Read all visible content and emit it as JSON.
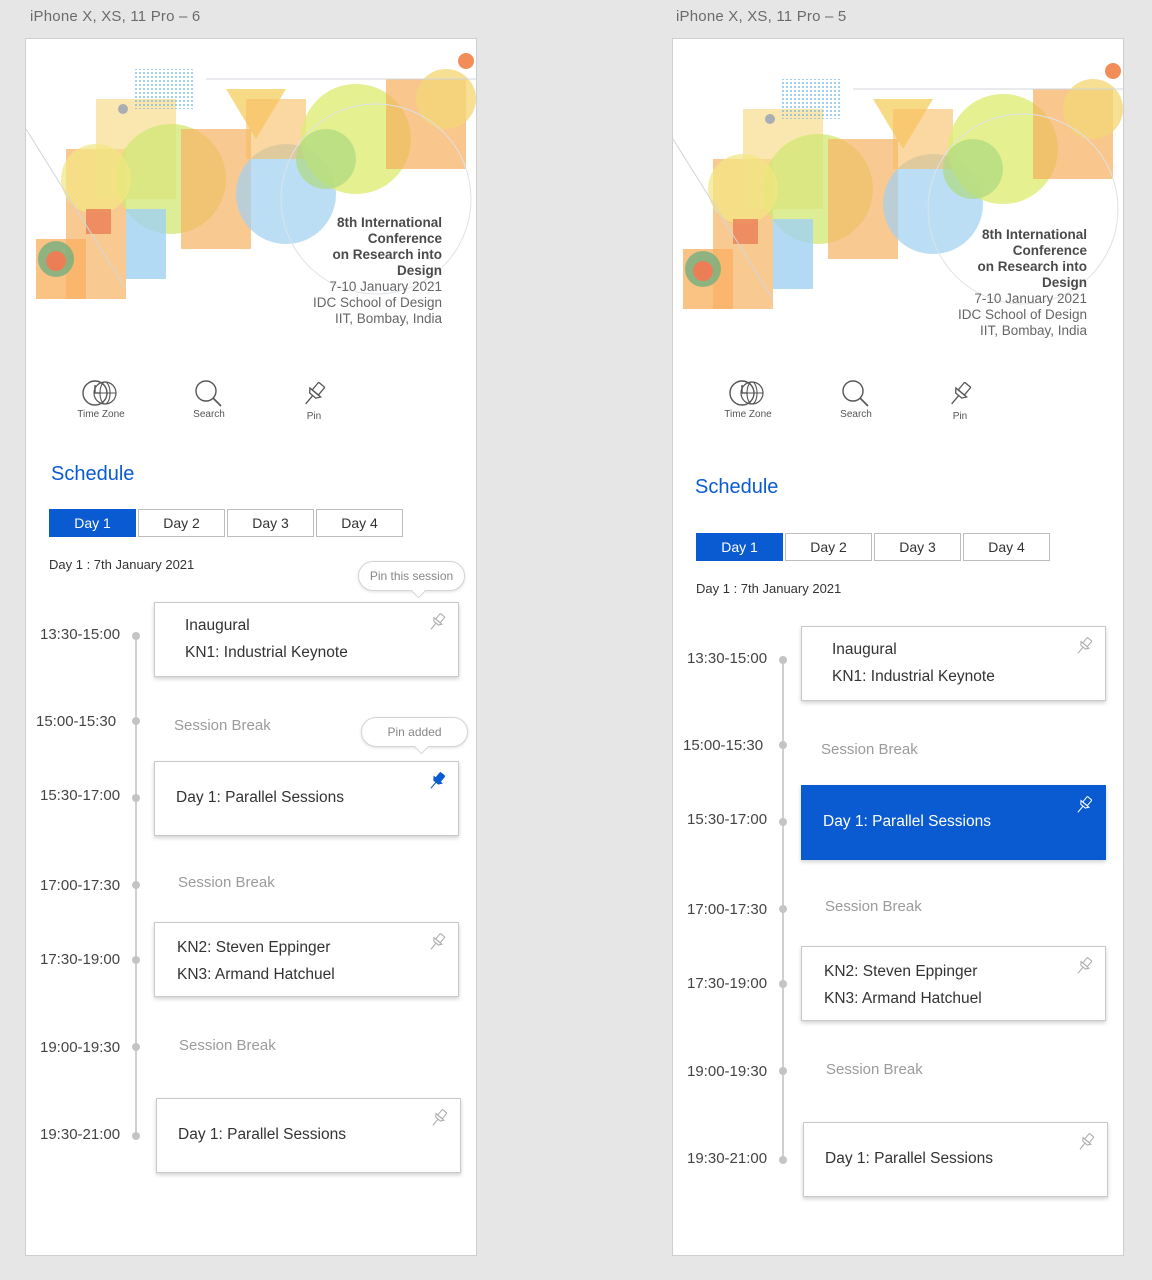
{
  "frames": [
    {
      "title": "iPhone X, XS, 11 Pro – 6",
      "conference": {
        "line1": "8th International",
        "line2": "Conference",
        "line3": "on Research into",
        "line4": "Design",
        "dates": "7-10 January 2021",
        "school": "IDC School of Design",
        "place": "IIT, Bombay, India"
      },
      "tools": [
        {
          "label": "Time Zone",
          "icon": "timezone-icon"
        },
        {
          "label": "Search",
          "icon": "search-icon"
        },
        {
          "label": "Pin",
          "icon": "pin-icon"
        }
      ],
      "schedule_title": "Schedule",
      "tabs": [
        "Day 1",
        "Day 2",
        "Day 3",
        "Day 4"
      ],
      "active_tab": "Day 1",
      "day_label": "Day 1 : 7th January 2021",
      "tooltips": [
        "Pin this session",
        "Pin added"
      ],
      "slots": [
        {
          "time": "13:30-15:00",
          "lines": [
            "Inaugural",
            "KN1: Industrial Keynote"
          ],
          "pinned": false
        },
        {
          "time": "15:00-15:30",
          "break": "Session Break"
        },
        {
          "time": "15:30-17:00",
          "lines": [
            "Day 1: Parallel Sessions"
          ],
          "pinned": true
        },
        {
          "time": "17:00-17:30",
          "break": "Session Break"
        },
        {
          "time": "17:30-19:00",
          "lines": [
            "KN2: Steven Eppinger",
            "KN3: Armand Hatchuel"
          ],
          "pinned": false
        },
        {
          "time": "19:00-19:30",
          "break": "Session Break"
        },
        {
          "time": "19:30-21:00",
          "lines": [
            "Day 1: Parallel Sessions"
          ],
          "pinned": false
        }
      ]
    },
    {
      "title": "iPhone X, XS, 11 Pro – 5",
      "conference": {
        "line1": "8th International",
        "line2": "Conference",
        "line3": "on Research into",
        "line4": "Design",
        "dates": "7-10 January 2021",
        "school": "IDC School of Design",
        "place": "IIT, Bombay, India"
      },
      "tools": [
        {
          "label": "Time Zone",
          "icon": "timezone-icon"
        },
        {
          "label": "Search",
          "icon": "search-icon"
        },
        {
          "label": "Pin",
          "icon": "pin-icon"
        }
      ],
      "schedule_title": "Schedule",
      "tabs": [
        "Day 1",
        "Day 2",
        "Day 3",
        "Day 4"
      ],
      "active_tab": "Day 1",
      "day_label": "Day 1 : 7th January 2021",
      "selected_session": "Day 1: Parallel Sessions",
      "slots": [
        {
          "time": "13:30-15:00",
          "lines": [
            "Inaugural",
            "KN1: Industrial Keynote"
          ]
        },
        {
          "time": "15:00-15:30",
          "break": "Session Break"
        },
        {
          "time": "15:30-17:00",
          "lines": [
            "Day 1: Parallel Sessions"
          ],
          "selected": true
        },
        {
          "time": "17:00-17:30",
          "break": "Session Break"
        },
        {
          "time": "17:30-19:00",
          "lines": [
            "KN2: Steven Eppinger",
            "KN3: Armand Hatchuel"
          ]
        },
        {
          "time": "19:00-19:30",
          "break": "Session Break"
        },
        {
          "time": "19:30-21:00",
          "lines": [
            "Day 1: Parallel Sessions"
          ]
        }
      ]
    }
  ],
  "colors": {
    "accent": "#0a5bd1",
    "timeline": "#cfcfcf",
    "break_text": "#9b9b9b"
  }
}
